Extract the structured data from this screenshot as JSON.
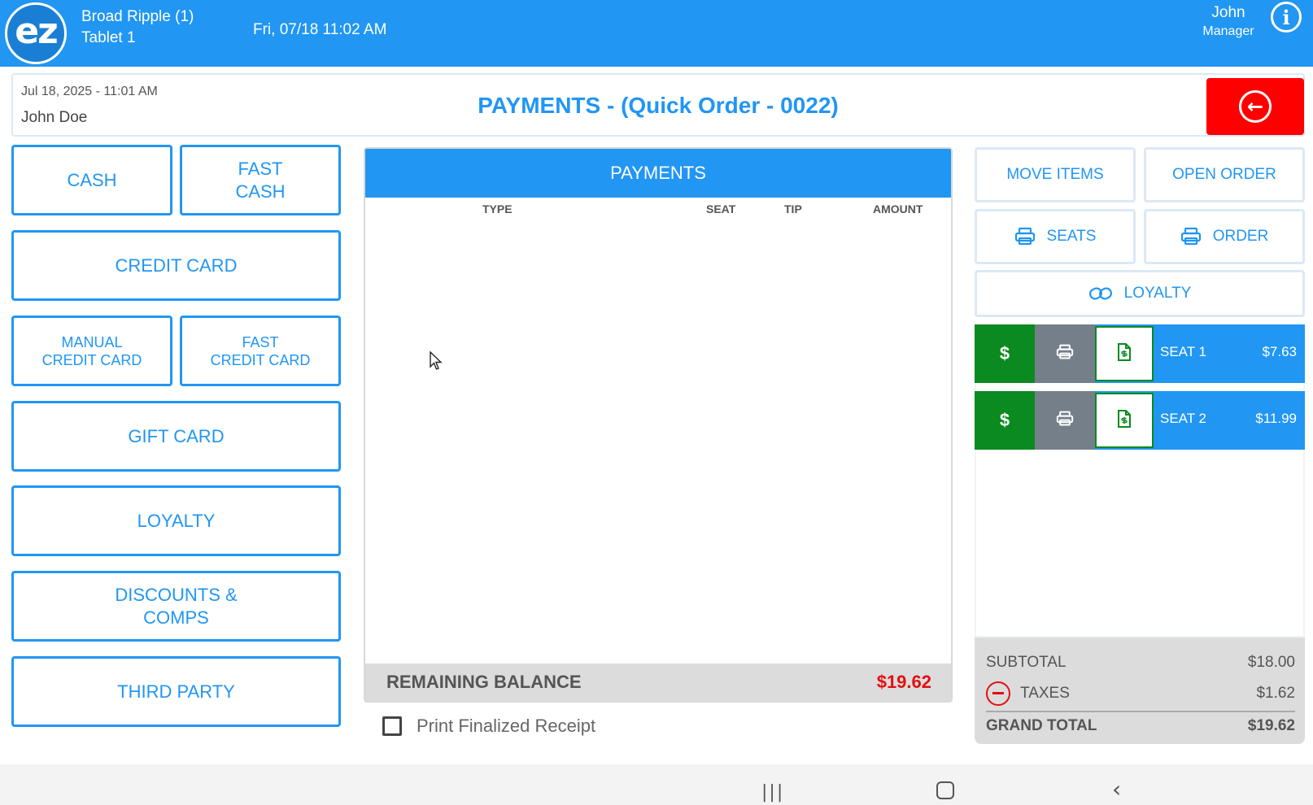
{
  "topbar": {
    "logo_text": "ez",
    "store_name": "Broad Ripple (1)",
    "device_name": "Tablet 1",
    "datetime": "Fri, 07/18 11:02 AM",
    "user_name": "John",
    "user_role": "Manager",
    "info_icon": "info-icon"
  },
  "header": {
    "order_date": "Jul 18, 2025  - 11:01 AM",
    "customer": "John Doe",
    "title": "PAYMENTS - (Quick Order - 0022)",
    "back_icon": "back-arrow-icon",
    "back_glyph": "←"
  },
  "payment_methods": {
    "cash": "CASH",
    "fast_cash_1": "FAST",
    "fast_cash_2": "CASH",
    "credit_card": "CREDIT CARD",
    "manual_cc_1": "MANUAL",
    "manual_cc_2": "CREDIT CARD",
    "fast_cc_1": "FAST",
    "fast_cc_2": "CREDIT CARD",
    "gift_card": "GIFT CARD",
    "loyalty": "LOYALTY",
    "discounts_1": "DISCOUNTS &",
    "discounts_2": "COMPS",
    "third_party": "THIRD PARTY"
  },
  "payments": {
    "title": "PAYMENTS",
    "columns": [
      "TYPE",
      "SEAT",
      "TIP",
      "AMOUNT"
    ],
    "rows": [],
    "remaining_label": "REMAINING BALANCE",
    "remaining_value": "$19.62",
    "print_receipt_label": "Print Finalized Receipt",
    "print_receipt_checked": false
  },
  "actions": {
    "move_items": "MOVE ITEMS",
    "open_order": "OPEN ORDER",
    "print_seats": "SEATS",
    "print_order": "ORDER",
    "loyalty": "LOYALTY"
  },
  "seats": [
    {
      "pay_glyph": "$",
      "name": "SEAT 1",
      "amount": "$7.63"
    },
    {
      "pay_glyph": "$",
      "name": "SEAT 2",
      "amount": "$11.99"
    }
  ],
  "totals": {
    "subtotal_label": "SUBTOTAL",
    "subtotal_value": "$18.00",
    "taxes_label": "TAXES",
    "taxes_value": "$1.62",
    "grand_label": "GRAND TOTAL",
    "grand_value": "$19.62"
  },
  "colors": {
    "primary": "#2196f3",
    "danger": "#ff0000",
    "balance": "#e31010",
    "pay_green": "#0a8a1f",
    "print_gray": "#757f8a"
  },
  "navbar": {
    "recent_glyph": "|||",
    "back_glyph": "‹"
  }
}
